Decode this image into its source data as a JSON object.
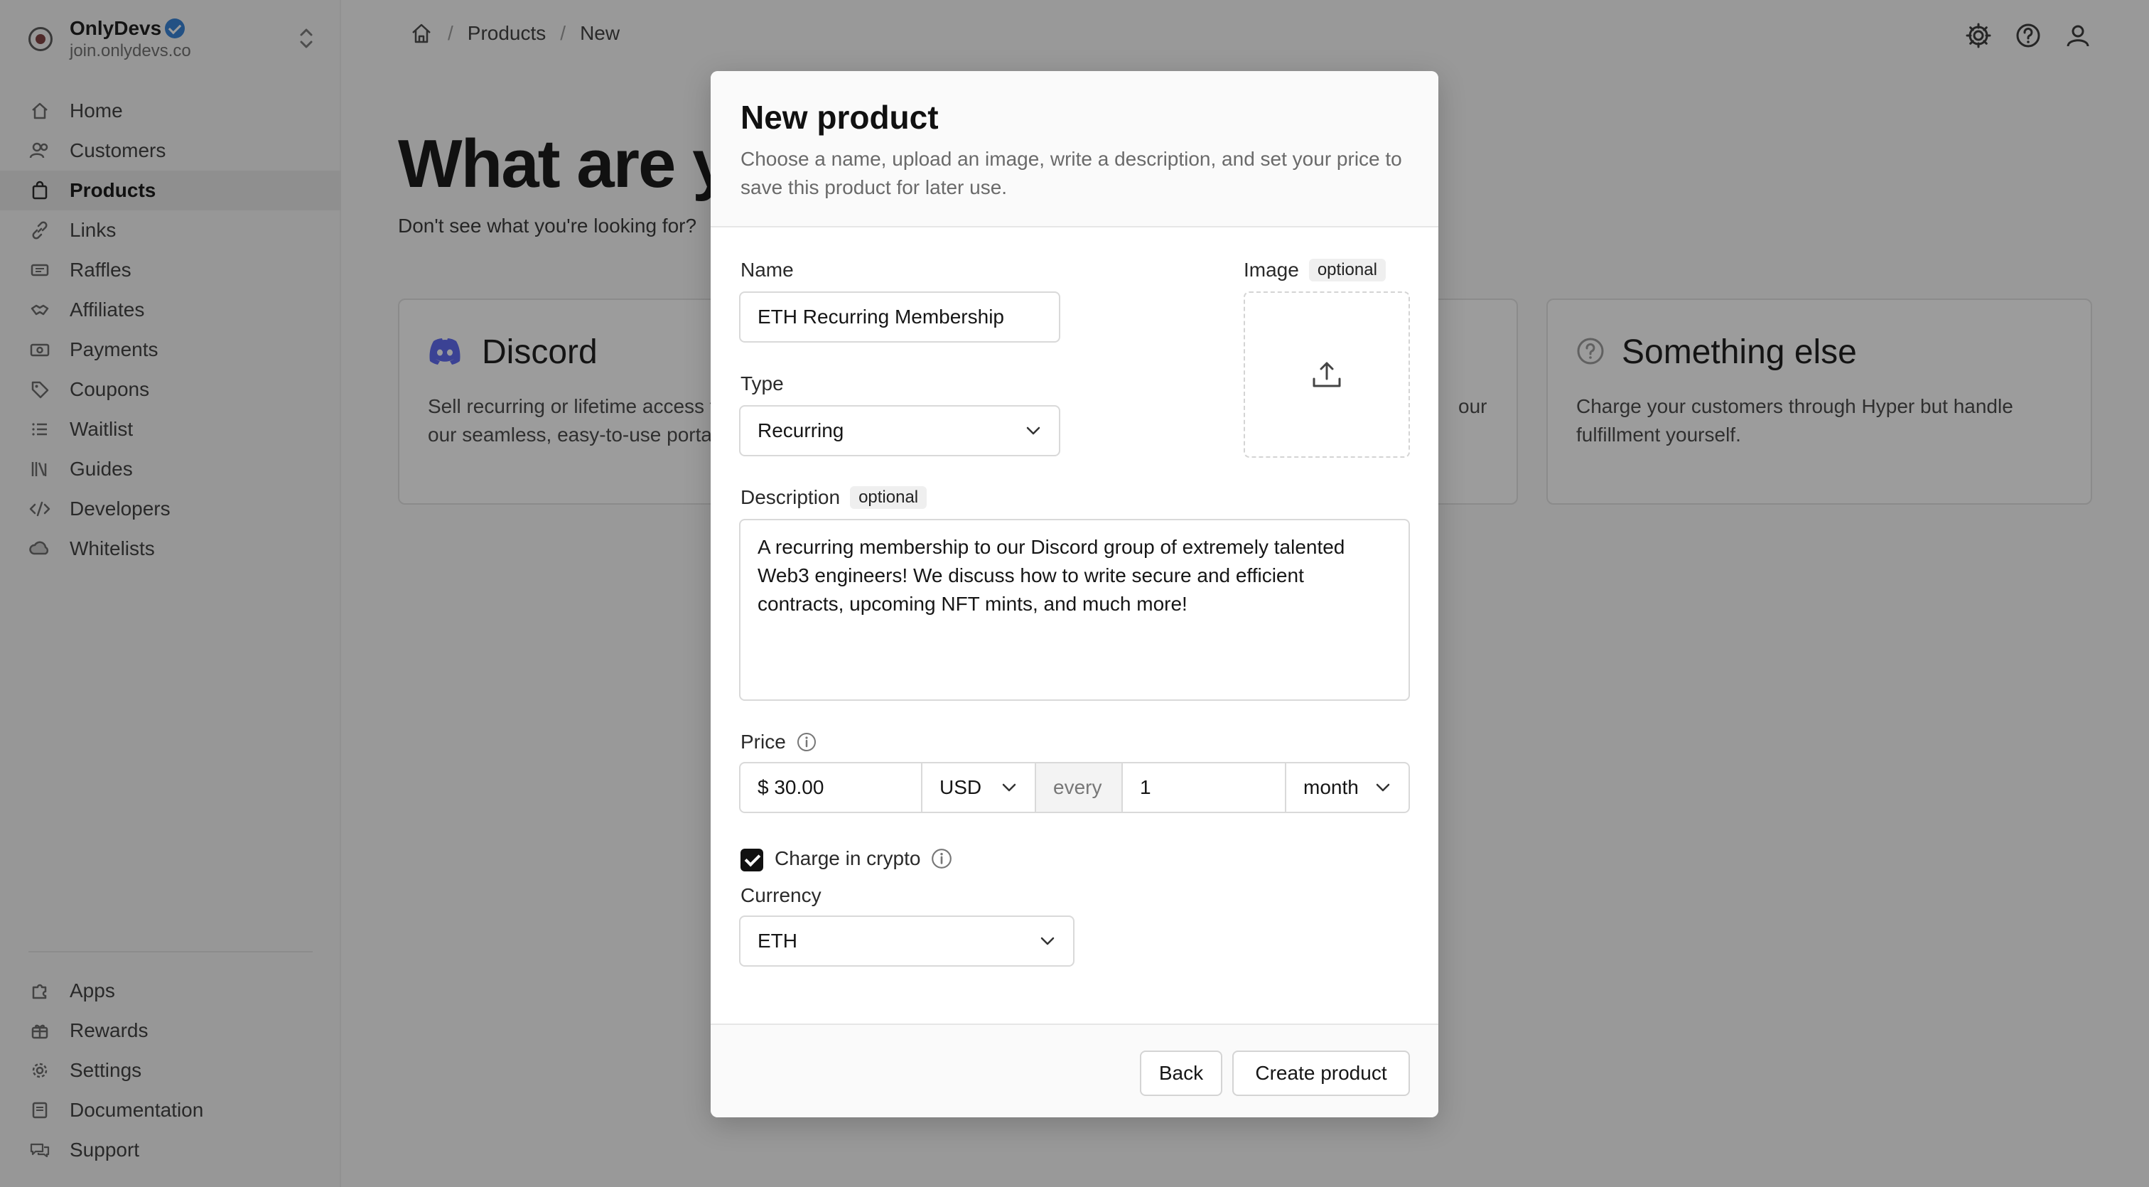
{
  "workspace": {
    "name": "OnlyDevs",
    "url": "join.onlydevs.co"
  },
  "sidebar": {
    "items": [
      {
        "label": "Home",
        "icon": "home-icon"
      },
      {
        "label": "Customers",
        "icon": "users-icon"
      },
      {
        "label": "Products",
        "icon": "bag-icon",
        "active": true
      },
      {
        "label": "Links",
        "icon": "link-icon"
      },
      {
        "label": "Raffles",
        "icon": "ticket-icon"
      },
      {
        "label": "Affiliates",
        "icon": "handshake-icon"
      },
      {
        "label": "Payments",
        "icon": "cash-icon"
      },
      {
        "label": "Coupons",
        "icon": "tag-icon"
      },
      {
        "label": "Waitlist",
        "icon": "list-icon"
      },
      {
        "label": "Guides",
        "icon": "books-icon"
      },
      {
        "label": "Developers",
        "icon": "code-icon"
      },
      {
        "label": "Whitelists",
        "icon": "cloud-icon"
      }
    ],
    "bottom_items": [
      {
        "label": "Apps",
        "icon": "puzzle-icon"
      },
      {
        "label": "Rewards",
        "icon": "gift-icon"
      },
      {
        "label": "Settings",
        "icon": "gear-icon"
      },
      {
        "label": "Documentation",
        "icon": "book-icon"
      },
      {
        "label": "Support",
        "icon": "chat-icon"
      }
    ]
  },
  "breadcrumb": [
    "Products",
    "New"
  ],
  "page": {
    "hero": "What are y",
    "hero_sub": "Don't see what you're looking for?",
    "cards": [
      {
        "title": "Discord",
        "desc": "Sell recurring or lifetime access to your server through our seamless, easy-to-use portal."
      },
      {
        "title": "Something else",
        "desc": "Charge your customers through Hyper but handle fulfillment yourself."
      }
    ],
    "partial_card_text": "our"
  },
  "modal": {
    "title": "New product",
    "description": "Choose a name, upload an image, write a description, and set your price to save this product for later use.",
    "name_label": "Name",
    "name_value": "ETH Recurring Membership",
    "image_label": "Image",
    "optional": "optional",
    "type_label": "Type",
    "type_value": "Recurring",
    "description_label": "Description",
    "description_value": "A recurring membership to our Discord group of extremely talented Web3 engineers! We discuss how to write secure and efficient contracts, upcoming NFT mints, and much more!",
    "price_label": "Price",
    "price_value": "$ 30.00",
    "price_currency": "USD",
    "every": "every",
    "interval_count": "1",
    "interval_unit": "month",
    "charge_crypto_label": "Charge in crypto",
    "charge_crypto_checked": true,
    "currency_label": "Currency",
    "currency_value": "ETH",
    "back_button": "Back",
    "create_button": "Create product"
  },
  "colors": {
    "accent": "#111111",
    "discord": "#5865f2",
    "verified": "#2f7fd6"
  }
}
